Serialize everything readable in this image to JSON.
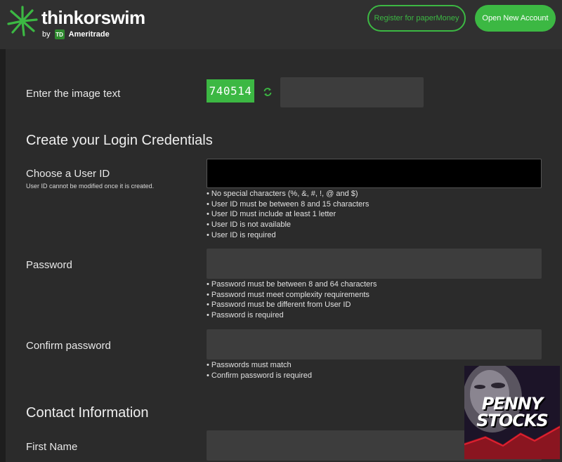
{
  "header": {
    "brand": "thinkorswim",
    "by": "by",
    "td": "TD",
    "ameritrade": "Ameritrade",
    "register_label": "Register for paperMoney",
    "open_account_label": "Open New Account"
  },
  "captcha": {
    "label": "Enter the image text",
    "code": "740514",
    "input_value": ""
  },
  "login_section": {
    "title": "Create your Login Credentials"
  },
  "user_id": {
    "label": "Choose a User ID",
    "sublabel": "User ID cannot be modified once it is created.",
    "value": "",
    "hints": [
      "No special characters (%, &, #, !, @ and $)",
      "User ID must be between 8 and 15 characters",
      "User ID must include at least 1 letter",
      "User ID is not available",
      "User ID is required"
    ]
  },
  "password": {
    "label": "Password",
    "value": "",
    "hints": [
      "Password must be between 8 and 64 characters",
      "Password must meet complexity requirements",
      "Password must be different from User ID",
      "Password is required"
    ]
  },
  "confirm_password": {
    "label": "Confirm password",
    "value": "",
    "hints": [
      "Passwords must match",
      "Confirm password is required"
    ]
  },
  "contact_section": {
    "title": "Contact Information"
  },
  "first_name": {
    "label": "First Name",
    "value": ""
  },
  "ad": {
    "line1": "PENNY",
    "line2": "STOCKS"
  },
  "colors": {
    "accent": "#3cb843",
    "background": "#2b2b2b",
    "field": "#3d3d3d"
  }
}
